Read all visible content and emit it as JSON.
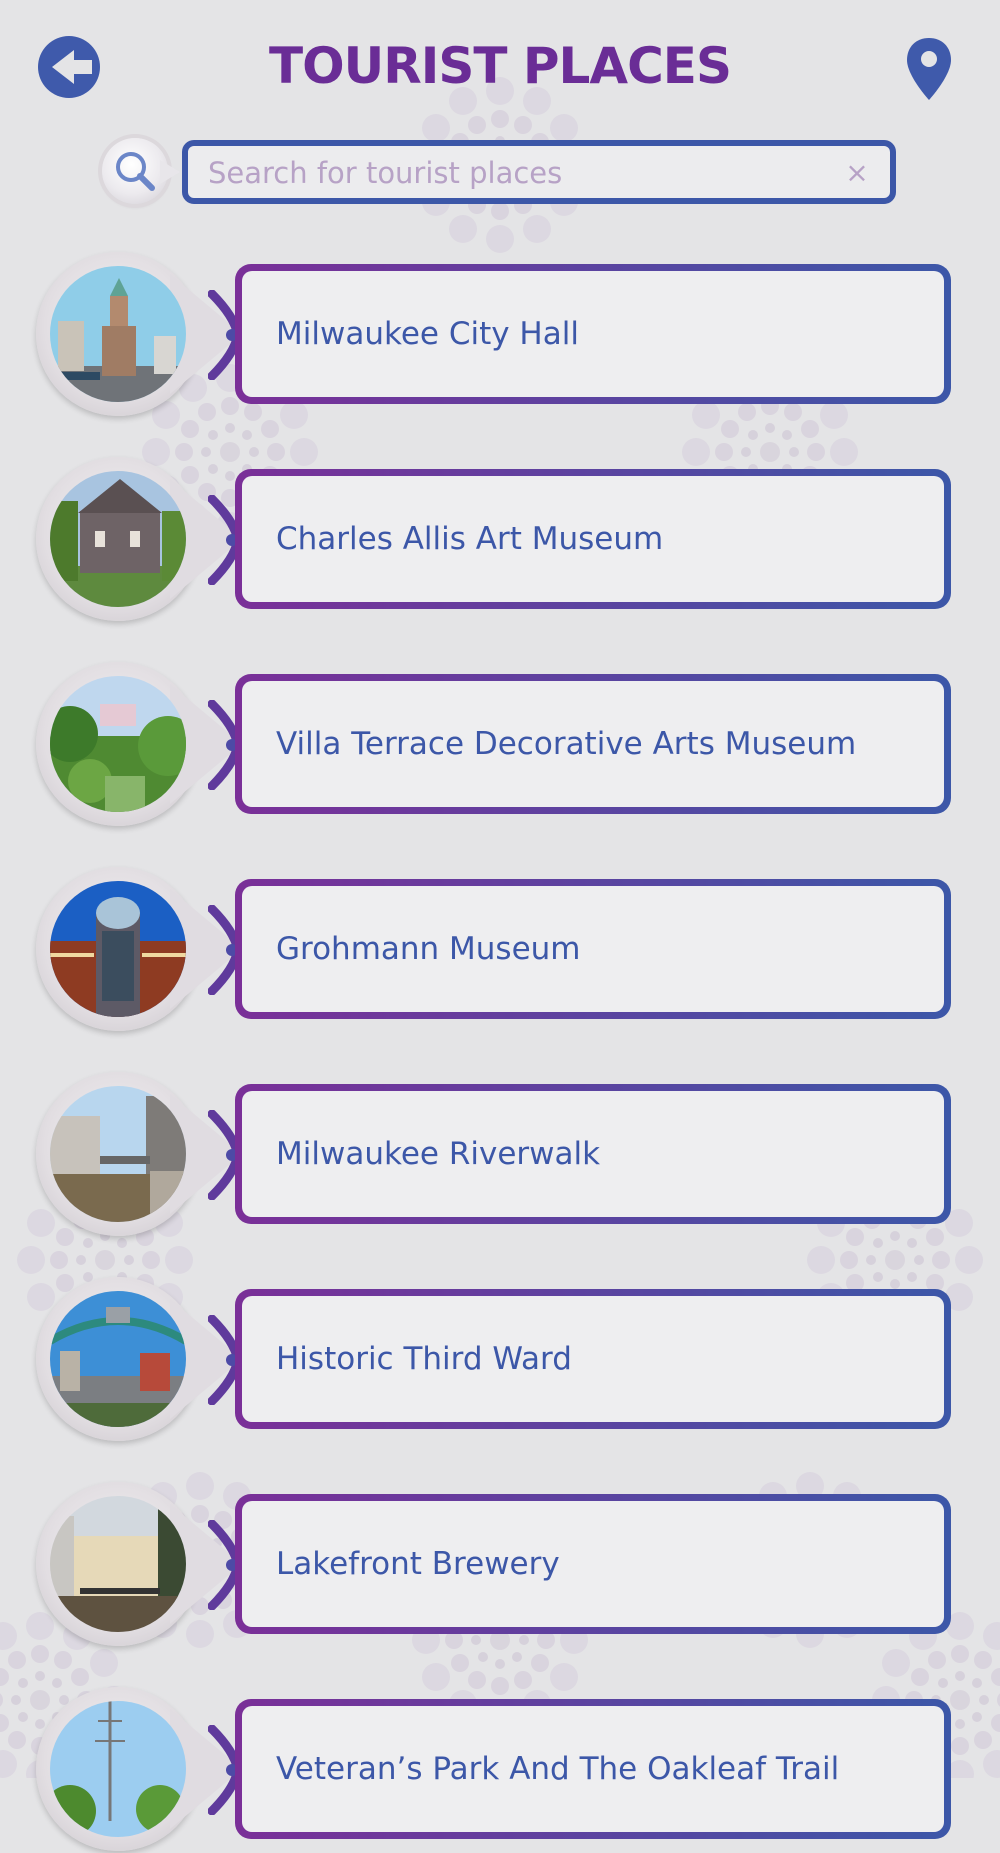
{
  "header": {
    "title": "TOURIST PLACES",
    "back_icon": "arrow-left-circle-icon",
    "location_icon": "map-pin-icon"
  },
  "search": {
    "placeholder": "Search for tourist places",
    "value": "",
    "search_icon": "magnifier-icon",
    "clear_symbol": "×"
  },
  "places": [
    {
      "name": "Milwaukee City Hall",
      "thumb": "city-hall-photo"
    },
    {
      "name": "Charles Allis Art Museum",
      "thumb": "mansion-photo"
    },
    {
      "name": "Villa Terrace Decorative Arts Museum",
      "thumb": "garden-villa-photo"
    },
    {
      "name": "Grohmann Museum",
      "thumb": "glass-dome-building-photo"
    },
    {
      "name": "Milwaukee Riverwalk",
      "thumb": "river-photo"
    },
    {
      "name": "Historic Third Ward",
      "thumb": "arch-bridge-photo"
    },
    {
      "name": "Lakefront Brewery",
      "thumb": "brewery-photo"
    },
    {
      "name": "Veteran’s Park And The Oakleaf Trail",
      "thumb": "park-tower-photo"
    }
  ],
  "colors": {
    "title_purple": "#6a2d96",
    "accent_blue": "#3c57a8",
    "background": "#e4e4e6",
    "card_fill": "#eeeef0",
    "placeholder": "#b7a2c6"
  }
}
